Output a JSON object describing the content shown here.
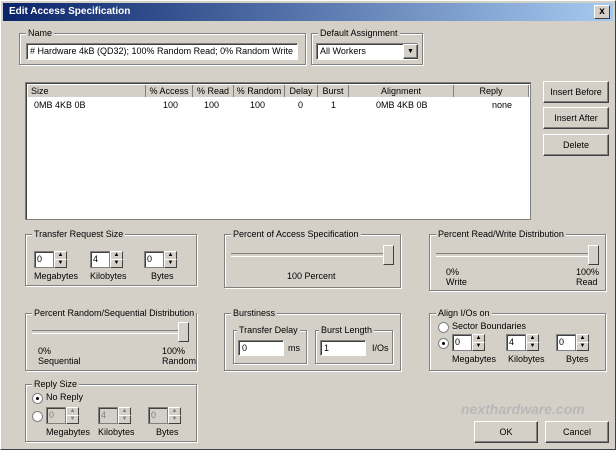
{
  "window": {
    "title": "Edit Access Specification",
    "close": "x"
  },
  "name": {
    "label": "Name",
    "value": "# Hardware 4kB (QD32); 100% Random Read; 0% Random Write"
  },
  "default_assignment": {
    "label": "Default Assignment",
    "value": "All Workers"
  },
  "table": {
    "headers": [
      "Size",
      "% Access",
      "% Read",
      "% Random",
      "Delay",
      "Burst",
      "Alignment",
      "Reply"
    ],
    "rows": [
      [
        "0MB   4KB   0B",
        "100",
        "100",
        "100",
        "0",
        "1",
        "0MB   4KB   0B",
        "none"
      ]
    ]
  },
  "buttons": {
    "insert_before": "Insert Before",
    "insert_after": "Insert After",
    "delete": "Delete",
    "ok": "OK",
    "cancel": "Cancel"
  },
  "transfer": {
    "label": "Transfer Request Size",
    "mb": "0",
    "kb": "4",
    "b": "0",
    "mb_lbl": "Megabytes",
    "kb_lbl": "Kilobytes",
    "b_lbl": "Bytes"
  },
  "percent_access": {
    "label": "Percent of Access Specification",
    "value_text": "100 Percent",
    "value": 100
  },
  "read_write": {
    "label": "Percent Read/Write Distribution",
    "left": "0%",
    "left2": "Write",
    "right": "100%",
    "right2": "Read",
    "value": 100
  },
  "random_seq": {
    "label": "Percent Random/Sequential Distribution",
    "left": "0%",
    "left2": "Sequential",
    "right": "100%",
    "right2": "Random",
    "value": 100
  },
  "burstiness": {
    "label": "Burstiness",
    "delay_label": "Transfer Delay",
    "delay_value": "0",
    "delay_unit": "ms",
    "burst_label": "Burst Length",
    "burst_value": "1",
    "burst_unit": "I/Os"
  },
  "align": {
    "label": "Align I/Os on",
    "sector": "Sector Boundaries",
    "mb": "0",
    "kb": "4",
    "b": "0",
    "mb_lbl": "Megabytes",
    "kb_lbl": "Kilobytes",
    "b_lbl": "Bytes"
  },
  "reply": {
    "label": "Reply Size",
    "no_reply": "No Reply",
    "mb": "0",
    "kb": "4",
    "b": "0",
    "mb_lbl": "Megabytes",
    "kb_lbl": "Kilobytes",
    "b_lbl": "Bytes"
  },
  "watermark": "nexthardware.com"
}
